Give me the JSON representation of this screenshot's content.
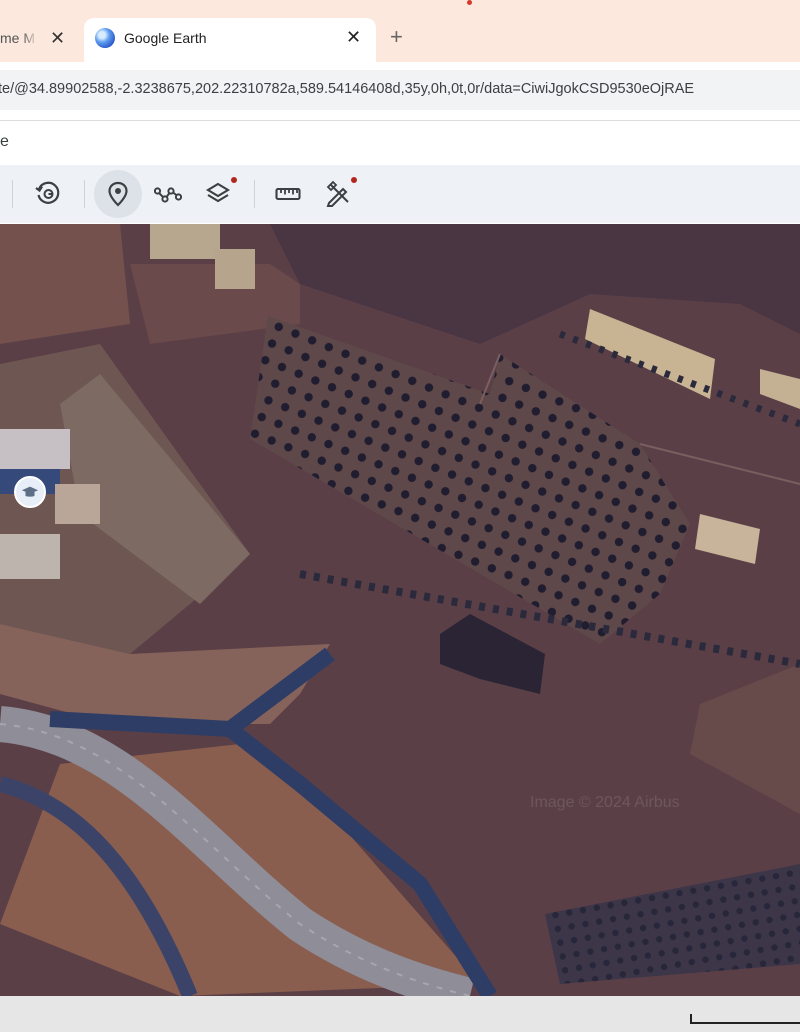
{
  "browser": {
    "tabs": [
      {
        "label": "me M",
        "active": false
      },
      {
        "label": "Google Earth",
        "active": true
      }
    ],
    "new_tab_label": "+",
    "close_glyph": "✕",
    "url": "te/@34.89902588,-2.3238675,202.22310782a,589.54146408d,35y,0h,0t,0r/data=CiwiJgokCSD9530eOjRAE"
  },
  "search": {
    "value": "e"
  },
  "toolbar": {
    "items": [
      {
        "name": "history-icon",
        "active": false
      },
      {
        "name": "map-pin-icon",
        "active": true
      },
      {
        "name": "path-icon",
        "active": false
      },
      {
        "name": "layers-icon",
        "active": false,
        "badge": true
      },
      {
        "name": "ruler-icon",
        "active": false
      },
      {
        "name": "create-tools-icon",
        "active": false,
        "badge": true
      }
    ]
  },
  "map": {
    "watermark": "Image © 2024 Airbus",
    "place_marker_icon": "graduation-cap-icon"
  },
  "colors": {
    "tab_strip": "#fce8dd",
    "toolbar": "#eef1f5",
    "terrain": "#5a3f47",
    "road": "#2e3d66",
    "badge": "#b3261e"
  }
}
